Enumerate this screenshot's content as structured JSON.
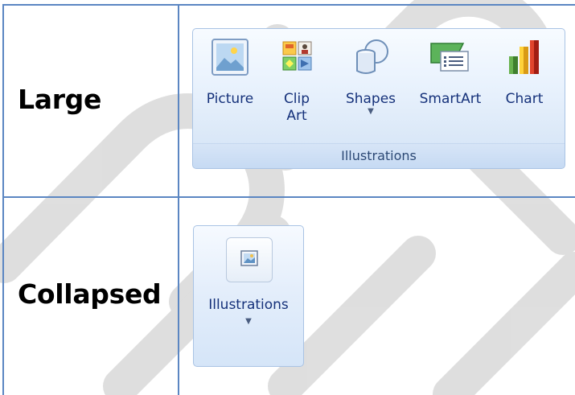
{
  "table": {
    "rows": [
      {
        "label": "Large"
      },
      {
        "label": "Collapsed"
      }
    ]
  },
  "large_group": {
    "buttons": [
      {
        "label": "Picture",
        "icon": "picture-icon"
      },
      {
        "label_line1": "Clip",
        "label_line2": "Art",
        "icon": "clip-art-icon"
      },
      {
        "label": "Shapes",
        "icon": "shapes-icon",
        "dropdown_arrow": "▼"
      },
      {
        "label": "SmartArt",
        "icon": "smartart-icon"
      },
      {
        "label": "Chart",
        "icon": "chart-icon"
      }
    ],
    "caption": "Illustrations"
  },
  "collapsed_group": {
    "label": "Illustrations",
    "icon": "illustrations-icon",
    "dropdown_arrow": "▼"
  },
  "colors": {
    "table_border": "#5b86c2",
    "ribbon_text": "#15317a",
    "watermark": "#d4d4d4"
  }
}
